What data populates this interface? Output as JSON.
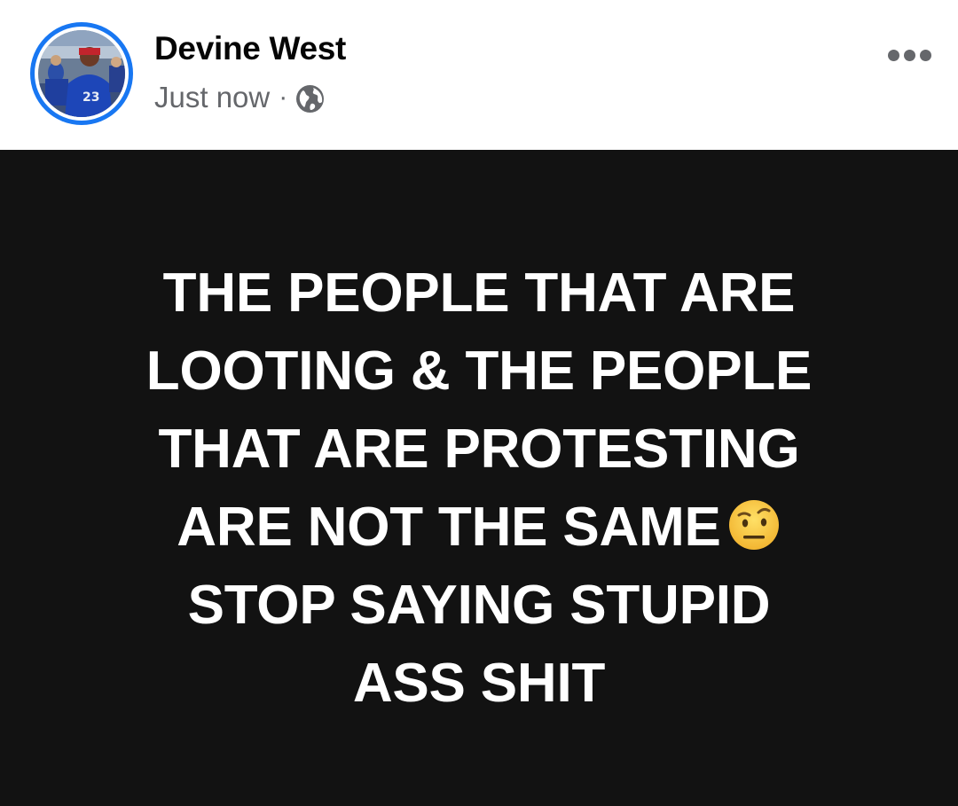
{
  "post": {
    "author": {
      "name": "Devine West",
      "avatar_icon": "avatar-photo",
      "avatar_ring_color": "#1877f2"
    },
    "timestamp": "Just now",
    "separator": "·",
    "audience_icon": "globe-icon",
    "audience": "Public",
    "more_icon": "more-options-icon",
    "body": {
      "background": "#121212",
      "text_color": "#ffffff",
      "lines": [
        "THE PEOPLE THAT ARE",
        "LOOTING & THE PEOPLE",
        "THAT ARE PROTESTING",
        "ARE NOT THE SAME",
        "STOP SAYING STUPID",
        "ASS SHIT"
      ],
      "emoji": "face-with-raised-eyebrow-emoji"
    }
  }
}
